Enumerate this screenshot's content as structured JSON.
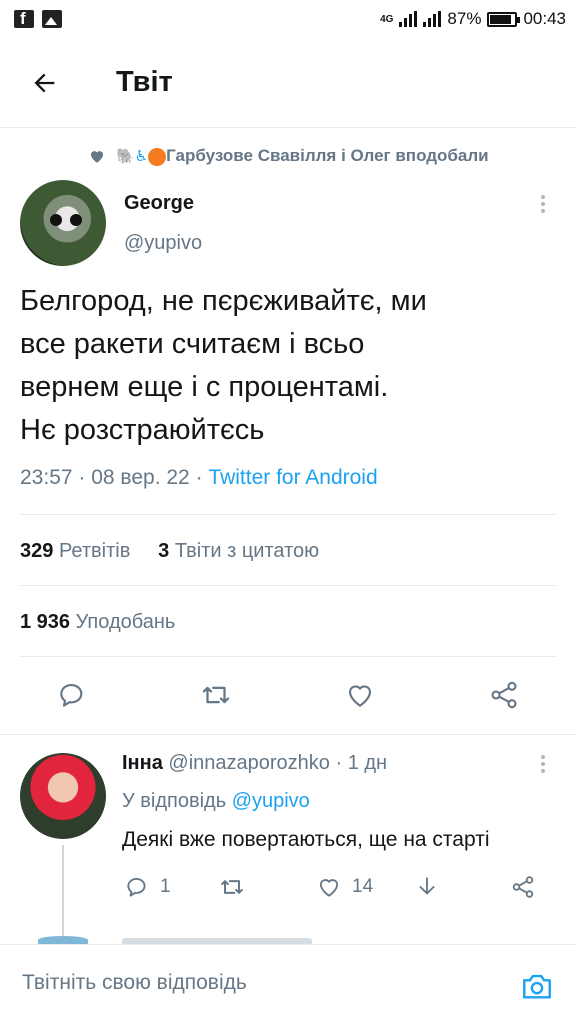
{
  "status_bar": {
    "network": "4G",
    "battery_percent": "87%",
    "battery_level": 0.87,
    "time": "00:43",
    "left_icons": [
      "facebook-icon",
      "image-icon"
    ]
  },
  "header": {
    "back_icon": "arrow-left-icon",
    "title": "Твіт"
  },
  "liked_by": {
    "icon": "heart-icon",
    "emoji": "🐘♿",
    "text": "Гарбузове Свавілля і Олег вподобали"
  },
  "tweet": {
    "author_name": "George",
    "author_handle": "@yupivo",
    "text_lines": [
      "Белгород, не пєрєживайтє, ми",
      "все ракети считаєм і всьо",
      "вернем еще і с процентамі.",
      "Нє розстраюйтєсь"
    ],
    "time": "23:57",
    "date": "08 вер. 22",
    "source": "Twitter for Android",
    "retweets_count": "329",
    "retweets_label": "Ретвітів",
    "quotes_count": "3",
    "quotes_label": "Твіти з цитатою",
    "likes_count": "1 936",
    "likes_label": "Уподобань"
  },
  "actions": [
    "reply-icon",
    "retweet-icon",
    "like-icon",
    "share-icon"
  ],
  "reply": {
    "author_name": "Інна",
    "author_handle": "@innazaporozhko",
    "age": "1 дн",
    "reply_to_label": "У відповідь",
    "reply_to_handle": "@yupivo",
    "text": "Деякі вже повертаються, ще на старті",
    "reply_count": "1",
    "like_count": "14"
  },
  "compose": {
    "placeholder": "Твітніть свою відповідь",
    "camera_icon": "camera-icon"
  },
  "colors": {
    "accent": "#1da1f2",
    "secondary_text": "#657786",
    "divider": "#e6ecf0"
  }
}
